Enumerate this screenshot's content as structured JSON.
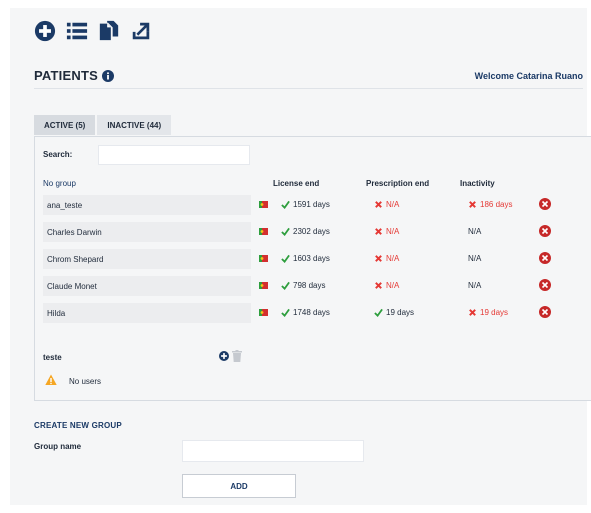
{
  "toolbar": {
    "items": [
      {
        "icon": "add-circle-icon"
      },
      {
        "icon": "list-icon"
      },
      {
        "icon": "copy-documents-icon"
      },
      {
        "icon": "export-icon"
      }
    ],
    "icon_color": "#1b3a66"
  },
  "header": {
    "title": "PATIENTS",
    "welcome": "Welcome Catarina Ruano"
  },
  "tabs": [
    {
      "label": "ACTIVE (5)",
      "active": true
    },
    {
      "label": "INACTIVE (44)",
      "active": false
    }
  ],
  "search": {
    "label": "Search:",
    "value": "",
    "placeholder": ""
  },
  "table": {
    "group_label": "No group",
    "columns": [
      "License end",
      "Prescription end",
      "Inactivity"
    ],
    "rows": [
      {
        "name": "ana_teste",
        "license": "1591 days",
        "license_ok": true,
        "prescription": "N/A",
        "prescription_ok": false,
        "inactivity": "186 days",
        "inactivity_alert": true
      },
      {
        "name": "Charles Darwin",
        "license": "2302 days",
        "license_ok": true,
        "prescription": "N/A",
        "prescription_ok": false,
        "inactivity": "N/A",
        "inactivity_alert": false
      },
      {
        "name": "Chrom Shepard",
        "license": "1603 days",
        "license_ok": true,
        "prescription": "N/A",
        "prescription_ok": false,
        "inactivity": "N/A",
        "inactivity_alert": false
      },
      {
        "name": "Claude Monet",
        "license": "798 days",
        "license_ok": true,
        "prescription": "N/A",
        "prescription_ok": false,
        "inactivity": "N/A",
        "inactivity_alert": false
      },
      {
        "name": "Hilda",
        "license": "1748 days",
        "license_ok": true,
        "prescription": "19 days",
        "prescription_ok": true,
        "inactivity": "19 days",
        "inactivity_alert": true
      }
    ]
  },
  "group2": {
    "label": "teste",
    "empty_text": "No users"
  },
  "create_group": {
    "title": "CREATE NEW GROUP",
    "name_label": "Group name",
    "name_value": "",
    "add_label": "ADD"
  },
  "colors": {
    "accent": "#1b3a66",
    "ok": "#2e9e3e",
    "alert": "#e53935",
    "warning": "#f5a623",
    "delete": "#c62828"
  }
}
